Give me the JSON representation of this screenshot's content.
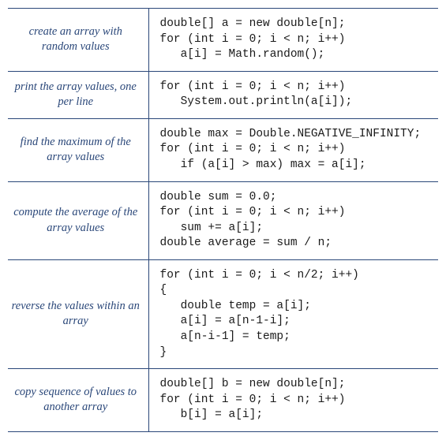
{
  "rows": [
    {
      "desc": "create an array\nwith random values",
      "code": "double[] a = new double[n];\nfor (int i = 0; i < n; i++)\n   a[i] = Math.random();"
    },
    {
      "desc": "print the array values,\none per line",
      "code": "for (int i = 0; i < n; i++)\n   System.out.println(a[i]);"
    },
    {
      "desc": "find the maximum of\nthe array values",
      "code": "double max = Double.NEGATIVE_INFINITY;\nfor (int i = 0; i < n; i++)\n   if (a[i] > max) max = a[i];"
    },
    {
      "desc": "compute the average of\nthe array values",
      "code": "double sum = 0.0;\nfor (int i = 0; i < n; i++)\n   sum += a[i];\ndouble average = sum / n;"
    },
    {
      "desc": "reverse the values\nwithin an array",
      "code": "for (int i = 0; i < n/2; i++)\n{\n   double temp = a[i];\n   a[i] = a[n-1-i];\n   a[n-i-1] = temp;\n}"
    },
    {
      "desc": "copy sequence of values\nto another array",
      "code": "double[] b = new double[n];\nfor (int i = 0; i < n; i++)\n   b[i] = a[i];"
    }
  ]
}
